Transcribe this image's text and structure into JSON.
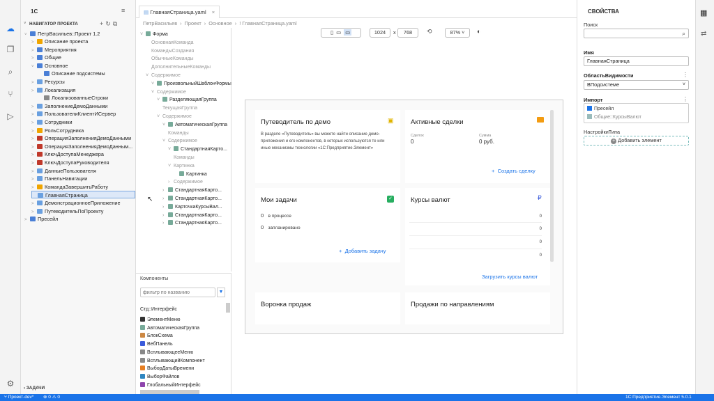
{
  "app": {
    "title": "1C"
  },
  "activity": {
    "items": [
      "cloud-icon",
      "files-icon",
      "search-icon",
      "git-branch-icon",
      "run-icon"
    ]
  },
  "navigator": {
    "header": "НАВИГАТОР ПРОЕКТА",
    "project": "ПетрВасильев::Проект 1.2",
    "items": [
      {
        "label": "Описание проекта",
        "color": "#f0a500"
      },
      {
        "label": "Мероприятия",
        "color": "#4a7fd6"
      },
      {
        "label": "Общие",
        "color": "#4a7fd6"
      },
      {
        "label": "Основное",
        "color": "#4a7fd6"
      },
      {
        "label": "Описание подсистемы",
        "color": "#4a7fd6"
      },
      {
        "label": "Ресурсы",
        "color": "#6aa0e0"
      },
      {
        "label": "Локализация",
        "color": "#6aa0e0"
      },
      {
        "label": "ЛокализованныеСтроки",
        "color": "#888888"
      },
      {
        "label": "ЗаполнениеДемоДанными",
        "color": "#6aa0e0"
      },
      {
        "label": "ПользователиКлиентИСервер",
        "color": "#6aa0e0"
      },
      {
        "label": "Сотрудники",
        "color": "#6aa0e0"
      },
      {
        "label": "РольСотрудника",
        "color": "#f0a500"
      },
      {
        "label": "ОперацияЗаполненияДемоДанными",
        "color": "#c0392b"
      },
      {
        "label": "ОперацияЗаполненияДемоДанным...",
        "color": "#c0392b"
      },
      {
        "label": "КлючДоступаМенеджера",
        "color": "#c0392b"
      },
      {
        "label": "КлючДоступаРуководителя",
        "color": "#c0392b"
      },
      {
        "label": "ДанныеПользователя",
        "color": "#6aa0e0"
      },
      {
        "label": "ПанельНавигации",
        "color": "#6aa0e0"
      },
      {
        "label": "КомандаЗавершитьРаботу",
        "color": "#f0a500"
      },
      {
        "label": "ГлавнаяСтраница",
        "color": "#6aa0e0"
      },
      {
        "label": "ДемонстрационноеПриложение",
        "color": "#6aa0e0"
      },
      {
        "label": "ПутеводительПоПроекту",
        "color": "#6aa0e0"
      },
      {
        "label": "Пресейл",
        "color": "#4a7fd6"
      }
    ],
    "tasks": "ЗАДАЧИ"
  },
  "editor": {
    "tab": "ГлавнаяСтраница.yaml",
    "breadcrumb": [
      "ПетрВасильев",
      "Проект",
      "Основное",
      "ГлавнаяСтраница.yaml"
    ],
    "width": "1024",
    "height": "768",
    "zoom": "87%",
    "x_sep": "x"
  },
  "outline": {
    "items": [
      {
        "label": "Форма",
        "dark": true
      },
      {
        "label": "ОсновнаяКоманда",
        "dark": false
      },
      {
        "label": "КомандыСоздания",
        "dark": false
      },
      {
        "label": "ОбычныеКоманды",
        "dark": false
      },
      {
        "label": "ДополнительныеКоманды",
        "dark": false
      },
      {
        "label": "Содержимое",
        "dark": false
      },
      {
        "label": "ПроизвольныйШаблонФормы",
        "dark": true
      },
      {
        "label": "Содержимое",
        "dark": false
      },
      {
        "label": "РазделяющаяГруппа",
        "dark": true
      },
      {
        "label": "ТекущаяГруппа",
        "dark": false
      },
      {
        "label": "Содержимое",
        "dark": false
      },
      {
        "label": "АвтоматическаяГруппа",
        "dark": true
      },
      {
        "label": "Команды",
        "dark": false
      },
      {
        "label": "Содержимое",
        "dark": false
      },
      {
        "label": "СтандартнаяКарто...",
        "dark": true
      },
      {
        "label": "Команды",
        "dark": false
      },
      {
        "label": "Картинка",
        "dark": false
      },
      {
        "label": "Картинка",
        "dark": true
      },
      {
        "label": "Содержимое",
        "dark": false
      },
      {
        "label": "СтандартнаяКарто...",
        "dark": true
      },
      {
        "label": "СтандартнаяКарто...",
        "dark": true
      },
      {
        "label": "КарточкаКурсыВал...",
        "dark": true
      },
      {
        "label": "СтандартнаяКарто...",
        "dark": true
      },
      {
        "label": "СтандартнаяКарто...",
        "dark": true
      }
    ]
  },
  "components": {
    "header": "Компоненты",
    "filter_placeholder": "фильтр по названию",
    "group": "Стд::Интерфейс",
    "items": [
      "ЭлементМеню",
      "АвтоматическаяГруппа",
      "БлокСхема",
      "ВебПанель",
      "ВсплывающееМеню",
      "ВсплывающийКомпонент",
      "ВыборДатыВремени",
      "ВыборФайлов",
      "ГлобальныйИнтерфейс"
    ]
  },
  "preview": {
    "guide": {
      "title": "Путеводитель по демо",
      "text": "В разделе «Путеводитель» вы можете найти описание демо-приложения и его компонентов, в которых используются те или иные механизмы технологии «1С:Предприятие.Элемент»"
    },
    "deals": {
      "title": "Активные сделки",
      "col1": "Сделок",
      "col2": "Сумма",
      "val1": "0",
      "val2": "0 руб.",
      "action": "Создать сделку"
    },
    "tasks": {
      "title": "Мои задачи",
      "rows": [
        {
          "n": "0",
          "label": "в процессе"
        },
        {
          "n": "0",
          "label": "запланировано"
        }
      ],
      "action": "Добавить задачу"
    },
    "rates": {
      "title": "Курсы валют",
      "values": [
        "0",
        "0",
        "0",
        "0"
      ],
      "action": "Загрузить курсы валют"
    },
    "funnel": {
      "title": "Воронка продаж"
    },
    "sales": {
      "title": "Продажи по направлениям"
    }
  },
  "properties": {
    "header": "СВОЙСТВА",
    "search_label": "Поиск",
    "name_label": "Имя",
    "name_value": "ГлавнаяСтраница",
    "scope_label": "ОбластьВидимости",
    "scope_value": "ВПодсистеме",
    "import_label": "Импорт",
    "import_items": [
      "Пресейл",
      "Общие::КурсыВалют"
    ],
    "type_label": "НастройкиТипа",
    "add_button": "Добавить элемент"
  },
  "status": {
    "branch": "Проект-dev*",
    "errors": "0",
    "warnings": "0",
    "platform": "1С:Предприятие.Элемент 5.0.1"
  }
}
